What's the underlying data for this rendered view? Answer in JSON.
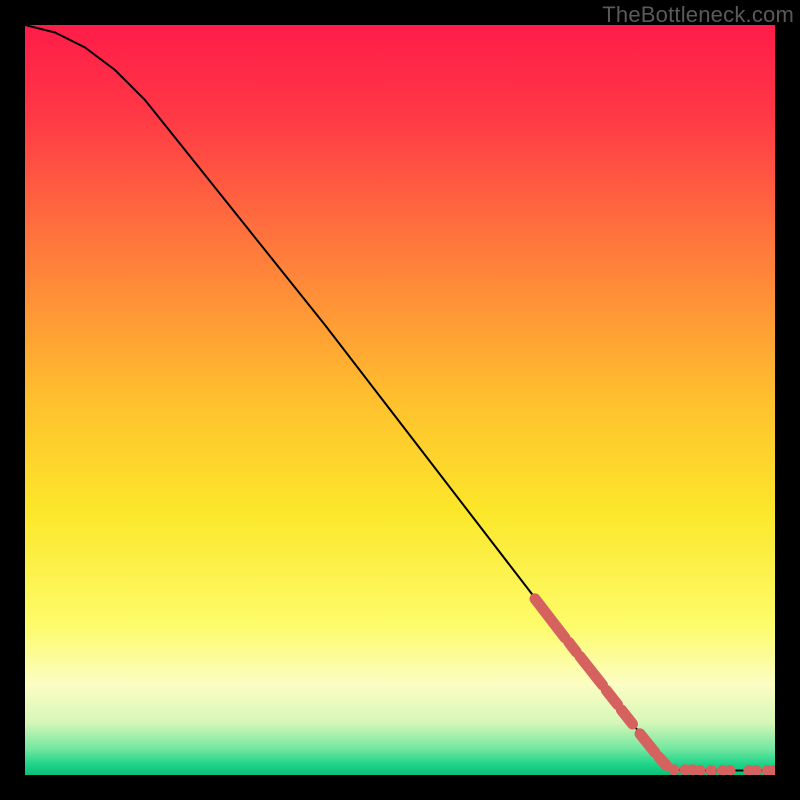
{
  "watermark": "TheBottleneck.com",
  "chart_data": {
    "type": "line",
    "title": "",
    "xlabel": "",
    "ylabel": "",
    "xlim": [
      0,
      100
    ],
    "ylim": [
      0,
      100
    ],
    "curve": [
      {
        "x": 0,
        "y": 100
      },
      {
        "x": 4,
        "y": 99
      },
      {
        "x": 8,
        "y": 97
      },
      {
        "x": 12,
        "y": 94
      },
      {
        "x": 16,
        "y": 90
      },
      {
        "x": 20,
        "y": 85
      },
      {
        "x": 30,
        "y": 72.5
      },
      {
        "x": 40,
        "y": 60
      },
      {
        "x": 50,
        "y": 47
      },
      {
        "x": 60,
        "y": 34
      },
      {
        "x": 70,
        "y": 21
      },
      {
        "x": 80,
        "y": 8
      },
      {
        "x": 85,
        "y": 2
      },
      {
        "x": 87,
        "y": 0.7
      },
      {
        "x": 90,
        "y": 0.6
      },
      {
        "x": 95,
        "y": 0.6
      },
      {
        "x": 100,
        "y": 0.6
      }
    ],
    "series": [
      {
        "name": "highlighted-segments",
        "color": "#d6625f",
        "type": "segments",
        "segments": [
          [
            {
              "x": 68,
              "y": 23.5
            },
            {
              "x": 72,
              "y": 18.3
            }
          ],
          [
            {
              "x": 72.5,
              "y": 17.7
            },
            {
              "x": 73.5,
              "y": 16.4
            }
          ],
          [
            {
              "x": 74,
              "y": 15.8
            },
            {
              "x": 77,
              "y": 12
            }
          ],
          [
            {
              "x": 77.5,
              "y": 11.3
            },
            {
              "x": 79,
              "y": 9.4
            }
          ],
          [
            {
              "x": 79.5,
              "y": 8.7
            },
            {
              "x": 81,
              "y": 6.8
            }
          ],
          [
            {
              "x": 82,
              "y": 5.5
            },
            {
              "x": 84,
              "y": 3
            }
          ],
          [
            {
              "x": 84.5,
              "y": 2.4
            },
            {
              "x": 85.5,
              "y": 1.3
            }
          ]
        ]
      },
      {
        "name": "highlighted-points",
        "color": "#d6625f",
        "type": "scatter",
        "points": [
          {
            "x": 86.5,
            "y": 0.7
          },
          {
            "x": 88,
            "y": 0.7
          },
          {
            "x": 89,
            "y": 0.7
          },
          {
            "x": 90,
            "y": 0.6
          },
          {
            "x": 91.5,
            "y": 0.6
          },
          {
            "x": 93,
            "y": 0.6
          },
          {
            "x": 94,
            "y": 0.6
          },
          {
            "x": 96.5,
            "y": 0.6
          },
          {
            "x": 97.5,
            "y": 0.6
          },
          {
            "x": 99,
            "y": 0.6
          },
          {
            "x": 99.8,
            "y": 0.6
          }
        ]
      }
    ],
    "background_gradient": {
      "stops": [
        {
          "pos": 0.0,
          "color": "#ff1c48"
        },
        {
          "pos": 0.12,
          "color": "#ff3846"
        },
        {
          "pos": 0.3,
          "color": "#ff7a3c"
        },
        {
          "pos": 0.5,
          "color": "#ffc02e"
        },
        {
          "pos": 0.65,
          "color": "#fce72a"
        },
        {
          "pos": 0.8,
          "color": "#fdfc6a"
        },
        {
          "pos": 0.88,
          "color": "#fcfdc3"
        },
        {
          "pos": 0.93,
          "color": "#d6f7b9"
        },
        {
          "pos": 0.965,
          "color": "#73e7a0"
        },
        {
          "pos": 0.985,
          "color": "#21d48a"
        },
        {
          "pos": 1.0,
          "color": "#0bbf7a"
        }
      ]
    }
  }
}
